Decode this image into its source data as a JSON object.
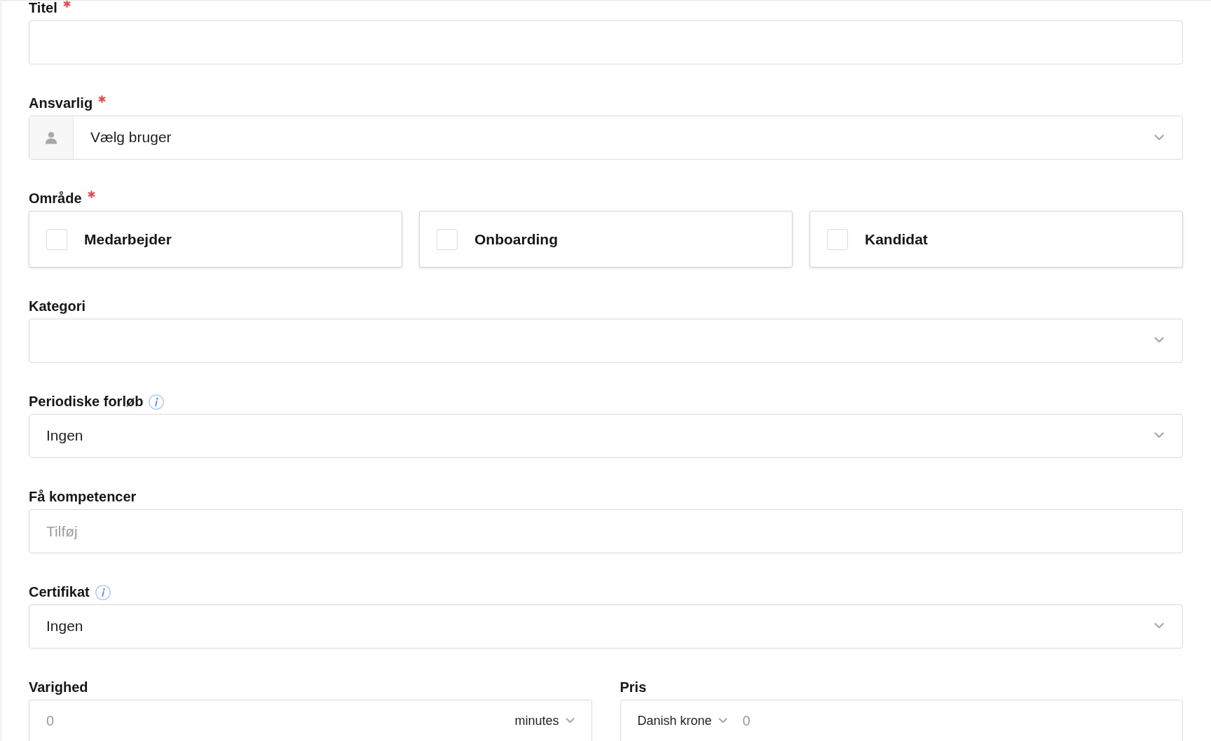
{
  "fields": [
    {
      "kind": "text",
      "label": "Titel",
      "required": true,
      "info": false
    },
    {
      "kind": "user_select",
      "label": "Ansvarlig",
      "required": true,
      "info": false,
      "value": "Vælg bruger"
    },
    {
      "kind": "checkboxes",
      "label": "Område",
      "required": true,
      "info": false,
      "options": [
        {
          "label": "Medarbejder",
          "checked": false
        },
        {
          "label": "Onboarding",
          "checked": false
        },
        {
          "label": "Kandidat",
          "checked": false
        }
      ]
    },
    {
      "kind": "select",
      "label": "Kategori",
      "required": false,
      "info": false
    },
    {
      "kind": "select",
      "label": "Periodiske forløb",
      "required": false,
      "info": true,
      "value": "Ingen"
    },
    {
      "kind": "tags",
      "label": "Få kompetencer",
      "required": false,
      "info": false,
      "placeholder": "Tilføj"
    },
    {
      "kind": "select",
      "label": "Certifikat",
      "required": false,
      "info": true,
      "value": "Ingen"
    }
  ],
  "bottom_row": [
    {
      "kind": "duration",
      "label": "Varighed",
      "required": false,
      "info": false,
      "placeholder": "0",
      "unit": "minutes"
    },
    {
      "kind": "price",
      "label": "Pris",
      "required": false,
      "info": false,
      "currency": "Danish krone",
      "placeholder": "0"
    }
  ]
}
